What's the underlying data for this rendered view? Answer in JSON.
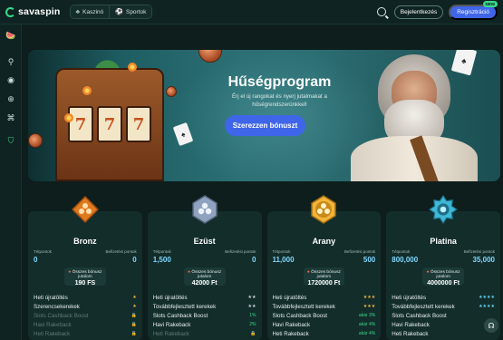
{
  "header": {
    "logo": "savaspin",
    "modes": [
      {
        "label": "Kaszinó",
        "icon": "casino-icon"
      },
      {
        "label": "Sportok",
        "icon": "sports-icon"
      }
    ],
    "login_label": "Bejelentkezés",
    "register_label": "Regisztráció",
    "register_badge": "NEW"
  },
  "sidebar": {
    "items": [
      {
        "icon": "promotions-icon"
      },
      {
        "icon": "bike-icon"
      },
      {
        "icon": "live-icon"
      },
      {
        "icon": "globe-icon"
      },
      {
        "icon": "gamepad-icon"
      },
      {
        "icon": "shield-icon"
      }
    ]
  },
  "hero": {
    "title": "Hűségprogram",
    "subtitle": "Érj el új rangokat és nyerj jutalmakat a hűségrendszerünkkel!",
    "cta": "Szerezzen bónuszt",
    "reels": [
      "7",
      "7",
      "7"
    ]
  },
  "tiers": [
    {
      "name": "Bronz",
      "points_label": "Tétpontok",
      "freebet_label": "Befizetési pontok",
      "points": "0",
      "freebet": "0",
      "bonus_label": "Összes bónusz jutalom",
      "bonus_value": "190 FS",
      "color": "#e07a1f",
      "features": [
        {
          "label": "Heti újratöltés",
          "value": "★",
          "state": "on"
        },
        {
          "label": "Szerencsekerekek",
          "value": "★",
          "state": "on"
        },
        {
          "label": "Slots Cashback Boost",
          "value": "🔒",
          "state": "off"
        },
        {
          "label": "Havi Rakeback",
          "value": "🔒",
          "state": "off"
        },
        {
          "label": "Heti Rakeback",
          "value": "🔒",
          "state": "off"
        }
      ]
    },
    {
      "name": "Ezüst",
      "points_label": "Tétpontok",
      "freebet_label": "Befizetési pontok",
      "points": "1,500",
      "freebet": "0",
      "bonus_label": "Összes bónusz jutalom",
      "bonus_value": "42000 Ft",
      "color": "#8fa3c0",
      "features": [
        {
          "label": "Heti újratöltés",
          "value": "★★",
          "state": "on"
        },
        {
          "label": "Továbbfejlesztett kerekek",
          "value": "★★",
          "state": "on"
        },
        {
          "label": "Slots Cashback Boost",
          "value": "1%",
          "state": "on"
        },
        {
          "label": "Havi Rakeback",
          "value": "2%",
          "state": "on"
        },
        {
          "label": "Heti Rakeback",
          "value": "🔒",
          "state": "off"
        }
      ]
    },
    {
      "name": "Arany",
      "points_label": "Tétpontok",
      "freebet_label": "Befizetési pontok",
      "points": "11,000",
      "freebet": "500",
      "bonus_label": "Összes bónusz jutalom",
      "bonus_value": "1720000 Ft",
      "color": "#f2b43a",
      "features": [
        {
          "label": "Heti újratöltés",
          "value": "★★★",
          "state": "on"
        },
        {
          "label": "Továbbfejlesztett kerekek",
          "value": "★★★",
          "state": "on"
        },
        {
          "label": "Slots Cashback Boost",
          "value": "akár 3%",
          "state": "on"
        },
        {
          "label": "Havi Rakeback",
          "value": "akár 4%",
          "state": "on"
        },
        {
          "label": "Heti Rakeback",
          "value": "akár 4%",
          "state": "on"
        }
      ]
    },
    {
      "name": "Platina",
      "points_label": "Tétpontok",
      "freebet_label": "Befizetési pontok",
      "points": "800,000",
      "freebet": "35,000",
      "bonus_label": "Összes bónusz jutalom",
      "bonus_value": "4000000 Ft",
      "color": "#3fb7d6",
      "features": [
        {
          "label": "Heti újratöltés",
          "value": "★★★★",
          "state": "on"
        },
        {
          "label": "Továbbfejlesztett kerekek",
          "value": "★★★★",
          "state": "on"
        },
        {
          "label": "Slots Cashback Boost",
          "value": "",
          "state": "on"
        },
        {
          "label": "Havi Rakeback",
          "value": "",
          "state": "on"
        },
        {
          "label": "Heti Rakeback",
          "value": "",
          "state": "on"
        }
      ]
    }
  ]
}
